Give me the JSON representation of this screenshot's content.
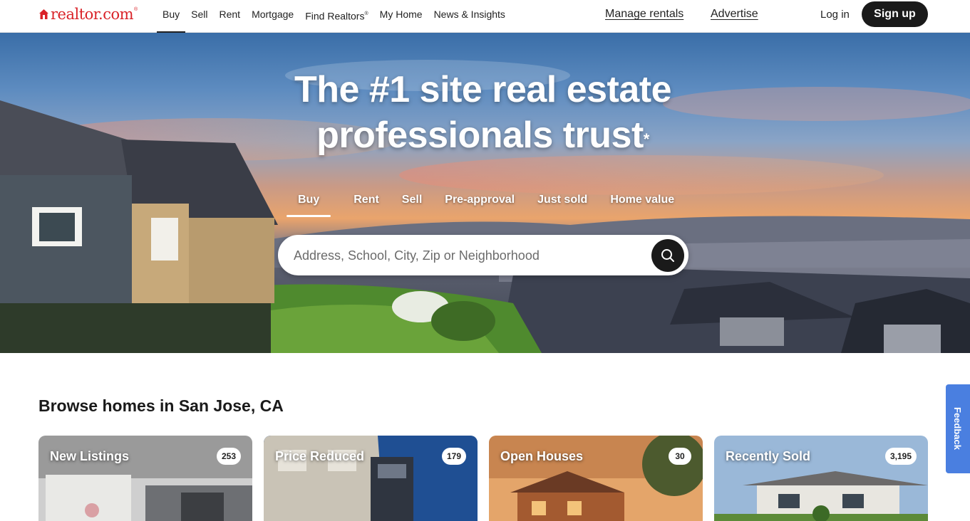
{
  "brand": {
    "name": "realtor.com",
    "reg": "®",
    "color": "#d92228"
  },
  "nav": [
    {
      "label": "Buy",
      "active": true
    },
    {
      "label": "Sell"
    },
    {
      "label": "Rent"
    },
    {
      "label": "Mortgage"
    },
    {
      "label": "Find Realtors",
      "sup": "®"
    },
    {
      "label": "My Home"
    },
    {
      "label": "News & Insights"
    }
  ],
  "header": {
    "manage_rentals": "Manage rentals",
    "advertise": "Advertise",
    "login": "Log in",
    "signup": "Sign up"
  },
  "hero": {
    "title_line1": "The #1 site real estate",
    "title_line2": "professionals trust",
    "title_mark": "*",
    "tabs": [
      "Buy",
      "Rent",
      "Sell",
      "Pre-approval",
      "Just sold",
      "Home value"
    ],
    "active_tab": "Buy",
    "search_placeholder": "Address, School, City, Zip or Neighborhood"
  },
  "browse": {
    "title": "Browse homes in San Jose, CA",
    "cards": [
      {
        "label": "New Listings",
        "count": "253"
      },
      {
        "label": "Price Reduced",
        "count": "179"
      },
      {
        "label": "Open Houses",
        "count": "30"
      },
      {
        "label": "Recently Sold",
        "count": "3,195"
      }
    ]
  },
  "feedback": "Feedback",
  "icons": [
    "house-logo-icon",
    "search-icon"
  ]
}
